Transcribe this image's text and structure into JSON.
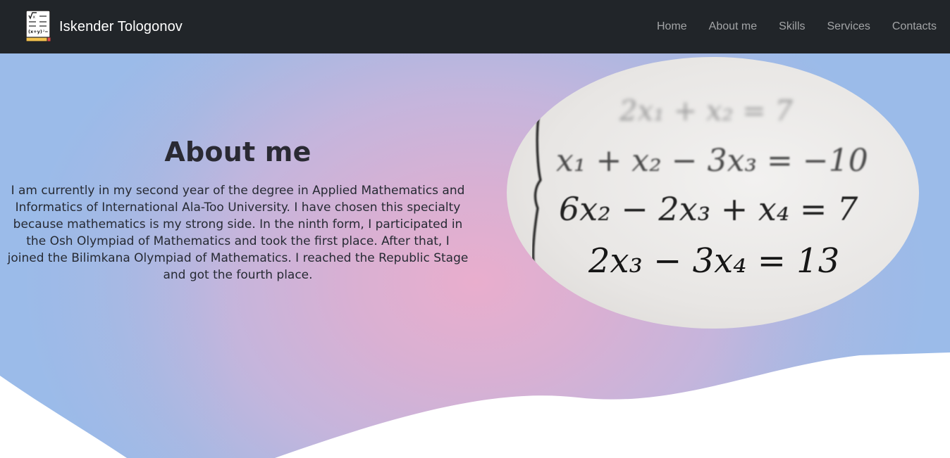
{
  "brand": {
    "name": "Iskender Tologonov",
    "logo_icon": "math-book-icon"
  },
  "nav": {
    "items": [
      {
        "label": "Home"
      },
      {
        "label": "About me"
      },
      {
        "label": "Skills"
      },
      {
        "label": "Services"
      },
      {
        "label": "Contacts"
      }
    ]
  },
  "about": {
    "title": "About me",
    "text": "I am currently in my second year of the degree in Applied Mathematics and Informatics of International Ala-Too University. I have chosen this specialty because mathematics is my strong side. In the ninth form, I participated in the Osh Olympiad of Mathematics and took the first place. After that, I joined the Bilimkana Olympiad of Mathematics. I reached the Republic Stage and got the fourth place."
  },
  "colors": {
    "navbar": "#212529",
    "gradient_center": "#e9aecd",
    "gradient_edge": "#9bbbe9",
    "wave": "#ffffff"
  }
}
